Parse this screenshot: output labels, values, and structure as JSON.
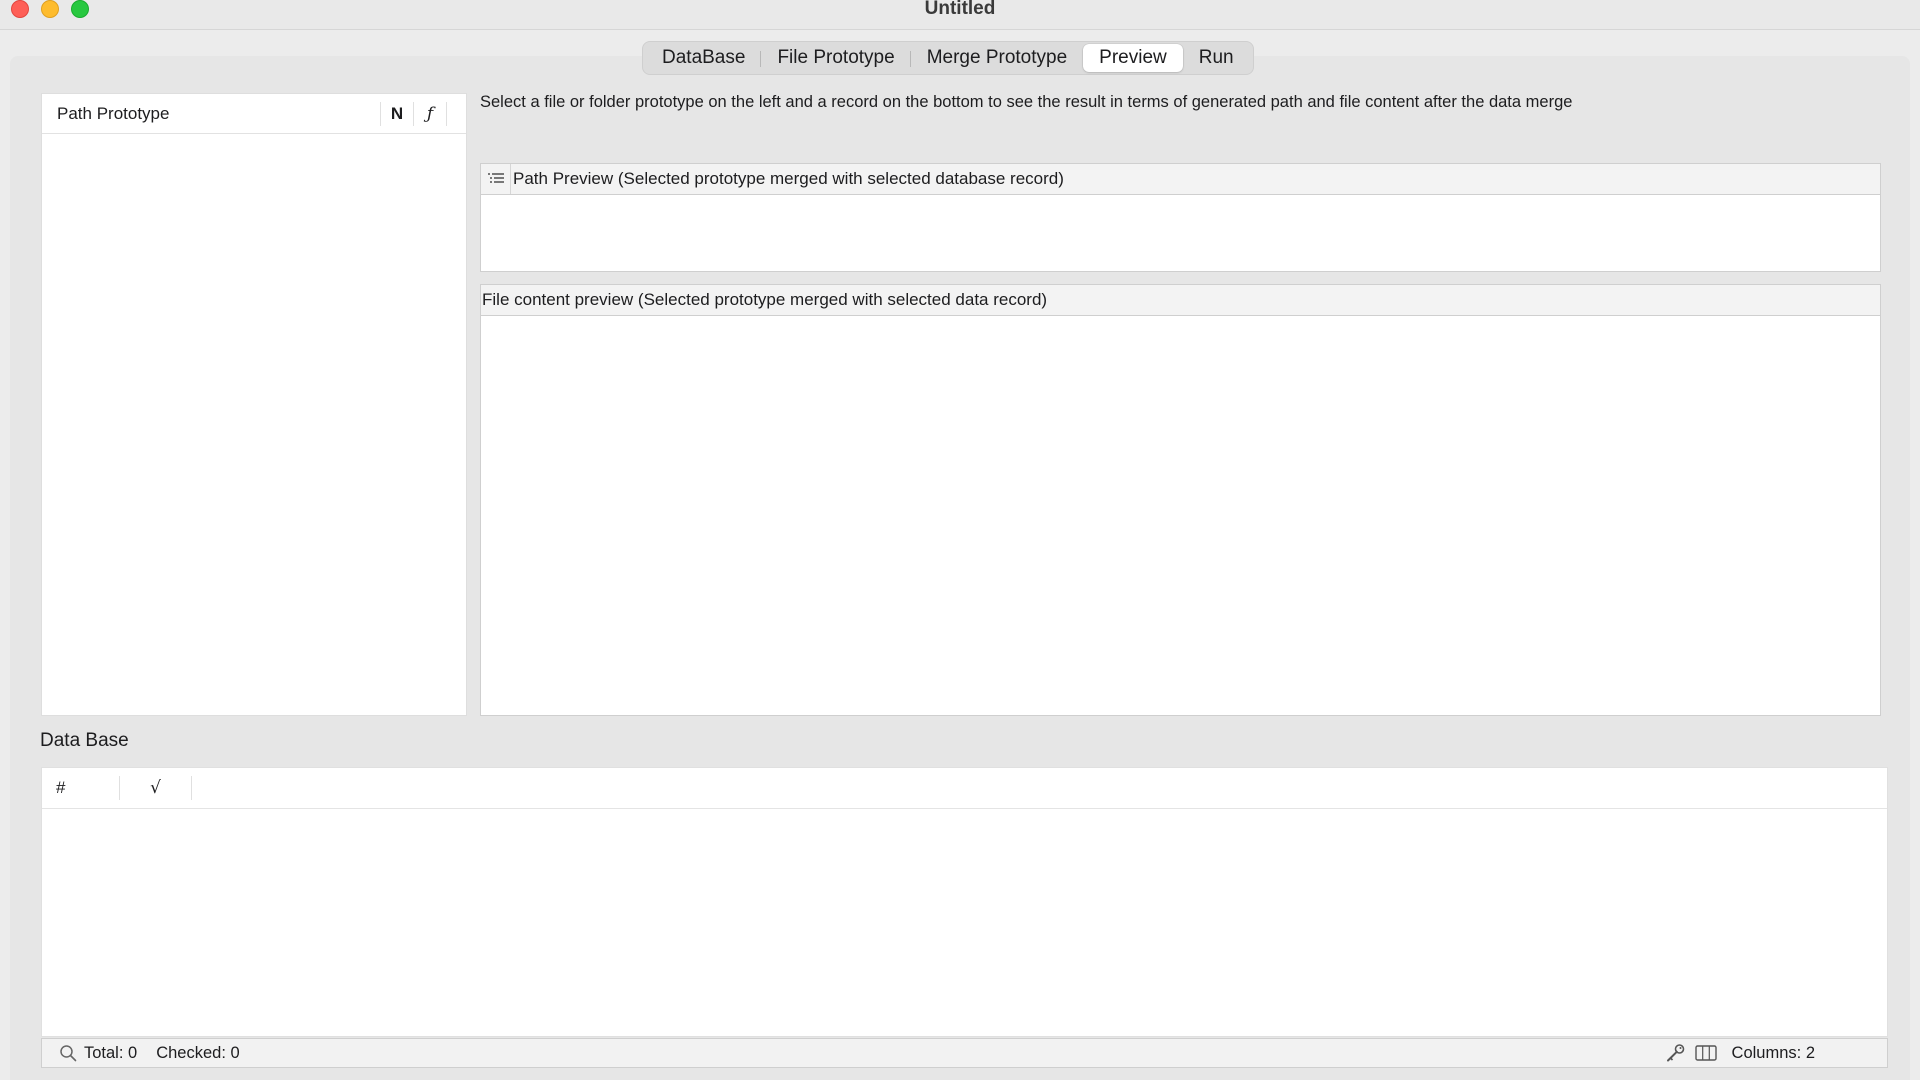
{
  "window": {
    "title": "Untitled"
  },
  "tabs": [
    {
      "label": "DataBase",
      "active": false
    },
    {
      "label": "File Prototype",
      "active": false
    },
    {
      "label": "Merge Prototype",
      "active": false
    },
    {
      "label": "Preview",
      "active": true
    },
    {
      "label": "Run",
      "active": false
    }
  ],
  "left_panel": {
    "header_label": "Path Prototype",
    "col_n": "N",
    "col_f": "ƒ"
  },
  "instruction": "Select a file or folder prototype  on the left and a record on the bottom to see the result in terms of generated path and file content after the data merge",
  "path_preview": {
    "header": "Path Preview (Selected prototype merged with selected database record)"
  },
  "file_preview": {
    "header": "File content preview (Selected prototype merged with selected data record)"
  },
  "database": {
    "title": "Data Base",
    "col_hash": "#",
    "col_check": "√"
  },
  "statusbar": {
    "total": "Total: 0",
    "checked": "Checked: 0",
    "columns": "Columns: 2"
  },
  "icons": {
    "list": "list-icon",
    "search": "search-icon",
    "key": "key-icon",
    "columns": "columns-icon"
  }
}
